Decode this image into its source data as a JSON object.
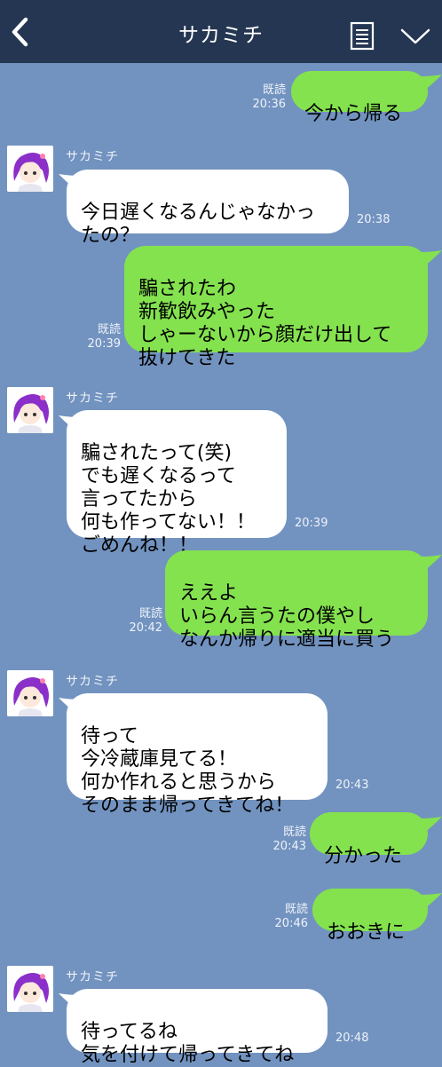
{
  "header": {
    "title": "サカミチ",
    "back_icon": "chevron-left-icon",
    "menu_icon": "document-list-icon",
    "dropdown_icon": "chevron-down-icon",
    "bg_color": "#243651"
  },
  "colors": {
    "background": "#7293c0",
    "outgoing_bubble": "#84e24f",
    "incoming_bubble": "#ffffff"
  },
  "messages": [
    {
      "dir": "out",
      "text": "今から帰る",
      "read": "既読",
      "time": "20:36"
    },
    {
      "dir": "in",
      "sender": "サカミチ",
      "text": "今日遅くなるんじゃなかっ\nたの？",
      "time": "20:38"
    },
    {
      "dir": "out",
      "text": "騙されたわ\n新歓飲みやった\nしゃーないから顔だけ出して\n抜けてきた",
      "read": "既読",
      "time": "20:39"
    },
    {
      "dir": "in",
      "sender": "サカミチ",
      "text": "騙されたって(笑)\nでも遅くなるって\n言ってたから\n何も作ってない！！\nごめんね！！",
      "time": "20:39"
    },
    {
      "dir": "out",
      "text": "ええよ\nいらん言うたの僕やし\nなんか帰りに適当に買う",
      "read": "既読",
      "time": "20:42"
    },
    {
      "dir": "in",
      "sender": "サカミチ",
      "text": "待って\n今冷蔵庫見てる！\n何か作れると思うから\nそのまま帰ってきてね！",
      "time": "20:43"
    },
    {
      "dir": "out",
      "text": "分かった",
      "read": "既読",
      "time": "20:43"
    },
    {
      "dir": "out",
      "text": "おおきに",
      "read": "既読",
      "time": "20:46"
    },
    {
      "dir": "in",
      "sender": "サカミチ",
      "text": "待ってるね\n気を付けて帰ってきてね",
      "time": "20:48"
    }
  ]
}
